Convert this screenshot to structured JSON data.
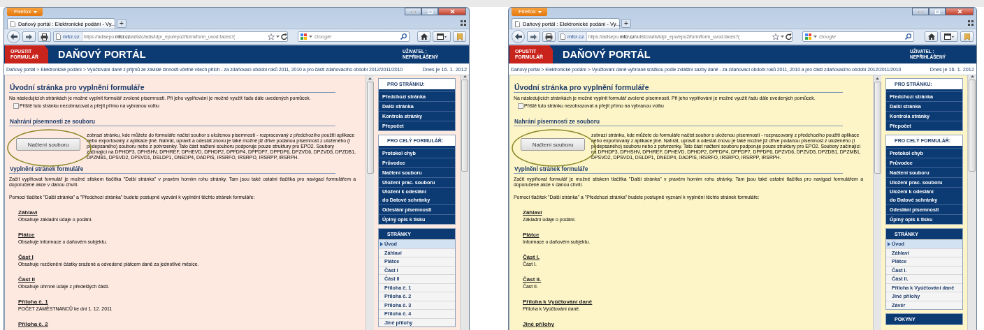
{
  "windows": [
    {
      "color": "#fde9e0",
      "firefox_button": "Firefox",
      "tab": {
        "title": "Daňový portál : Elektronické podání - Vy...",
        "new_tab": "+"
      },
      "address": {
        "identity": "mfcr.cz",
        "url": "https://adisepo.**mfcr.cz**/adistc/adis/idpr_epo/epo2/form/form_uvod.faces?("
      },
      "search": {
        "placeholder": "Google"
      },
      "portal": {
        "exit_button": "OPUSTIT\nFORMULÁŘ",
        "title": "DAŇOVÝ PORTÁL",
        "user_label": "UŽIVATEL :",
        "user_value": "NEPŘIHLÁŠENÝ"
      },
      "breadcrumb": {
        "separator": ">",
        "items": [
          "Daňový portál",
          "Elektronické podání",
          "Vyúčtování daně z příjmů ze závislé činnosti včetně všech příloh - za zdaňovací období roků 2011, 2010 a pro části zdaňovacího období 2012/2011/2010"
        ],
        "date": "Dnes je 16. 1. 2012"
      },
      "content": {
        "heading": "Úvodní stránka pro vyplnění formuláře",
        "intro": "Na následujících stránkách je možné vyplnit formulář zvolené písemnosti. Při jeho vyplňování je možné využít řadu dále uvedených pomůcek.",
        "checkbox": {
          "label": "Příště tuto stránku nezobrazovat a přejít přímo na vybranou volbu",
          "checked": false
        },
        "load_heading": "Nahrání písemnosti ze souboru",
        "load_button": "Načtení souboru",
        "load_text": "zobrazí stránku, kde můžete do formuláře načíst soubor s uloženou písemností - rozpracovaný z předchozího použití aplikace nebo exportovaný z aplikace jiné. Nahrát, upravit a odeslat znovu je také možné již dříve podanou písemnost z uloženého (i podepsaného) souboru nebo z potvrzenky. Tato část načtení souboru podporuje pouze struktury pro EPO2. Soubory začínající na DPHDP3, DPHSHV, DPHREF, DPHEVD, DPHDP2, DPFDP4, DPPDP7, DPPDP6, DPZVD6, DPZVD5, DPZDB1, DPZMB1, DPSVD2, DPSVD1, DSLDP1, DNEDP4, DADPIS, IRSRFO, IRSRPO, IRSRPP, IRSRPH.",
        "fill_heading": "Vyplnění stránek formuláře",
        "paragraphs": [
          "Začít vyplňovat formulář je možné stiskem tlačítka \"Další stránka\" v pravém horním rohu stránky. Tam jsou také ostatní tlačítka pro navigaci formulářem a doporučené akce v danou chvíli.",
          "Pomocí tlačítek \"Další stránka\" a \"Předchozí stránka\" budete postupně vyzváni k vyplnění těchto stránek formuláře:"
        ],
        "pages": [
          {
            "title": "Záhlaví",
            "description": "Obsahuje základní údaje o podání."
          },
          {
            "title": "Plátce",
            "description": "Obsahuje informace o daňovém subjektu."
          },
          {
            "title": "Část I",
            "description": "Obsahuje rozčlenění částky sražené a odvedené plátcem daně za jednotlivé měsíce."
          },
          {
            "title": "Část II",
            "description": "Obsahuje úhrnné údaje z předešlých částí."
          },
          {
            "title": "Příloha č. 1",
            "description": "POČET ZAMĚSTNANCŮ ke dni 1. 12. 2011"
          },
          {
            "title": "Příloha č. 2"
          }
        ]
      },
      "sidebar": [
        {
          "kind": "menu",
          "title": "PRO STRÁNKU:",
          "items": [
            "Předchozí stránka",
            "Další stránka",
            "Kontrola stránky",
            "Přepočet"
          ]
        },
        {
          "kind": "menu",
          "title": "PRO CELÝ FORMULÁŘ:",
          "items": [
            "Protokol chyb",
            "Průvodce",
            "Načtení souboru",
            "Uložení prac. souboru",
            "Uložení k odeslání\ndo Datové schránky",
            "Odeslání písemnosti",
            "Úplný opis k tisku"
          ]
        },
        {
          "kind": "pages",
          "title": "STRÁNKY",
          "items": [
            {
              "label": "Úvod",
              "selected": true
            },
            {
              "label": "Záhlaví",
              "selected": false
            },
            {
              "label": "Plátce",
              "selected": false
            },
            {
              "label": "Část I",
              "selected": false
            },
            {
              "label": "Část II",
              "selected": false
            },
            {
              "label": "Příloha č. 1",
              "selected": false
            },
            {
              "label": "Příloha č. 2",
              "selected": false
            },
            {
              "label": "Příloha č. 3",
              "selected": false
            },
            {
              "label": "Příloha č. 4",
              "selected": false
            },
            {
              "label": "Jiné přílohy",
              "selected": false
            }
          ]
        }
      ]
    },
    {
      "color": "#fdf5c8",
      "firefox_button": "Firefox",
      "tab": {
        "title": "Daňový portál : Elektronické podání - Vy...",
        "new_tab": "+"
      },
      "address": {
        "identity": "mfcr.cz",
        "url": "https://adisepo.**mfcr.cz**/adistc/adis/idpr_epo/epo2/form/form_uvod.faces?("
      },
      "search": {
        "placeholder": "Google"
      },
      "portal": {
        "exit_button": "OPUSTIT\nFORMULÁŘ",
        "title": "DAŇOVÝ PORTÁL",
        "user_label": "UŽIVATEL :",
        "user_value": "NEPŘIHLÁŠENÝ"
      },
      "breadcrumb": {
        "separator": ">",
        "items": [
          "Daňový portál",
          "Elektronické podání",
          "Vyúčtování daně vybírané srážkou podle zvláštní sazby daně - za zdaňovací období roků 2011, 2010 a pro části zdaňovacího období 2012/2011/2010"
        ],
        "date": "Dnes je 16. 1. 2012"
      },
      "content": {
        "heading": "Úvodní stránka pro vyplnění formuláře",
        "intro": "Na následujících stránkách je možné vyplnit formulář zvolené písemnosti. Při jeho vyplňování je možné využít řadu dále uvedených pomůcek.",
        "checkbox": {
          "label": "Příště tuto stránku nezobrazovat a přejít přímo na vybranou volbu",
          "checked": false
        },
        "load_heading": "Nahrání písemnosti ze souboru",
        "load_button": "Načtení souboru",
        "load_text": "zobrazí stránku, kde můžete do formuláře načíst soubor s uloženou písemností - rozpracovaný z předchozího použití aplikace nebo exportovaný z aplikace jiné. Nahrát, upravit a odeslat znovu je také možné již dříve podanou písemnost z uloženého (i podepsaného) souboru nebo z potvrzenky. Tato část načtení souboru podporuje pouze struktury pro EPO2. Soubory začínající na DPHDP3, DPHSHV, DPHREF, DPHEVD, DPHDP2, DPFDP4, DPPDP7, DPPDP6, DPZVD6, DPZVD5, DPZDB1, DPZMB1, DPSVD2, DPSVD1, DSLDP1, DNEDP4, DADPIS, IRSRFO, IRSRPO, IRSRPP, IRSRPH.",
        "fill_heading": "Vyplnění stránek formuláře",
        "paragraphs": [
          "Začít vyplňovat formulář je možné stiskem tlačítka \"Další stránka\" v pravém horním rohu stránky. Tam jsou také ostatní tlačítka pro navigaci formulářem a doporučené akce v danou chvíli.",
          "Pomocí tlačítek \"Další stránka\" a \"Předchozí stránka\" budete postupně vyzváni k vyplnění těchto stránek formuláře:"
        ],
        "pages": [
          {
            "title": "Záhlaví",
            "description": "Základní údaje o podání."
          },
          {
            "title": "Plátce",
            "description": "Informace o daňovém subjektu."
          },
          {
            "title": "Část I.",
            "description": "Část I."
          },
          {
            "title": "Část II.",
            "description": "Část II."
          },
          {
            "title": "Příloha k Vyúčtování daně",
            "description": "Příloha k Vyúčtování daně."
          },
          {
            "title": "Jiné přílohy"
          }
        ]
      },
      "sidebar": [
        {
          "kind": "menu",
          "title": "PRO STRÁNKU:",
          "items": [
            "Předchozí stránka",
            "Další stránka",
            "Kontrola stránky",
            "Přepočet"
          ]
        },
        {
          "kind": "menu",
          "title": "PRO CELÝ FORMULÁŘ:",
          "items": [
            "Protokol chyb",
            "Průvodce",
            "Načtení souboru",
            "Uložení prac. souboru",
            "Uložení k odeslání\ndo Datové schránky",
            "Odeslání písemnosti",
            "Úplný opis k tisku"
          ]
        },
        {
          "kind": "pages",
          "title": "STRÁNKY",
          "items": [
            {
              "label": "Úvod",
              "selected": true
            },
            {
              "label": "Záhlaví",
              "selected": false
            },
            {
              "label": "Plátce",
              "selected": false
            },
            {
              "label": "Část I.",
              "selected": false
            },
            {
              "label": "Část II.",
              "selected": false
            },
            {
              "label": "Příloha k Vyúčtování daně",
              "selected": false
            },
            {
              "label": "Jiné přílohy",
              "selected": false
            },
            {
              "label": "Závěr",
              "selected": false
            }
          ]
        },
        {
          "kind": "pages",
          "title": "POKYNY"
        }
      ]
    }
  ]
}
